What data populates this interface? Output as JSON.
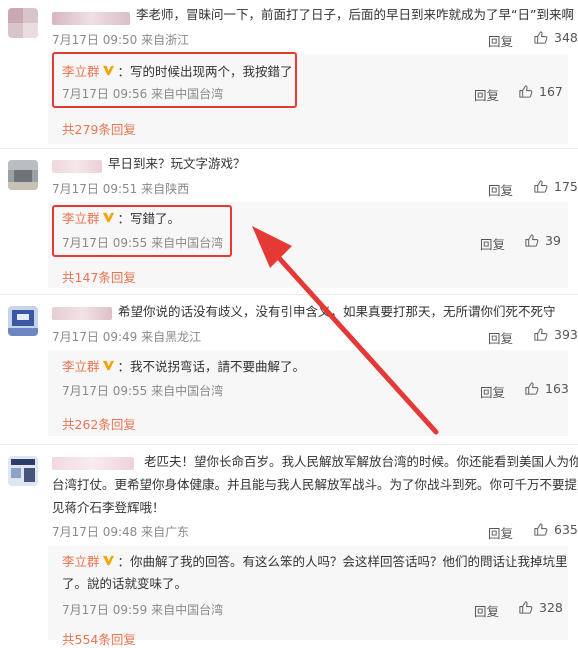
{
  "comments": [
    {
      "text": "李老师，冒昧问一下，前面打了日子，后面的早日到来咋就成为了早“日”到来啊",
      "meta": "7月17日 09:50 来自浙江",
      "reply_label": "回复",
      "likes": "348",
      "reply": {
        "author": "李立群",
        "text": "：写的时候出现两个，我按錯了",
        "meta": "7月17日 09:56 来自中国台湾",
        "reply_label": "回复",
        "likes": "167"
      },
      "more": "共279条回复"
    },
    {
      "text": "早日到来？玩文字游戏？",
      "meta": "7月17日 09:51 来自陕西",
      "reply_label": "回复",
      "likes": "175",
      "reply": {
        "author": "李立群",
        "text": "：写錯了。",
        "meta": "7月17日 09:55 来自中国台湾",
        "reply_label": "回复",
        "likes": "39"
      },
      "more": "共147条回复"
    },
    {
      "text": "希望你说的话没有歧义，没有引申含义，如果真要打那天，无所谓你们死不死守",
      "meta": "7月17日 09:49 来自黑龙江",
      "reply_label": "回复",
      "likes": "393",
      "reply": {
        "author": "李立群",
        "text": "：我不说拐弯话，請不要曲解了。",
        "meta": "7月17日 09:55 来自中国台湾",
        "reply_label": "回复",
        "likes": "163"
      },
      "more": "共262条回复"
    },
    {
      "text_lines": [
        "老匹夫！望你长命百岁。我人民解放军解放台湾的时候。你还能看到美国人为你",
        "台湾打仗。更希望你身体健康。并且能与我人民解放军战斗。为了你战斗到死。你可千万不要提前",
        "见蒋介石李登辉哦！"
      ],
      "meta": "7月17日 09:48 来自广东",
      "reply_label": "回复",
      "likes": "635",
      "reply": {
        "author": "李立群",
        "text_lines": [
          "：你曲解了我的回答。有这么笨的人吗？会这样回答话吗？他们的問话让我掉坑里",
          "了。說的话就变味了。"
        ],
        "meta": "7月17日 09:59 来自中国台湾",
        "reply_label": "回复",
        "likes": "328"
      },
      "more": "共554条回复"
    }
  ],
  "colors": {
    "author": "#eb7350",
    "annotation_red": "#e53935",
    "panel_bg": "#f7f7f7",
    "meta_text": "#8a8a8a"
  },
  "icons": {
    "like": "thumbs-up-icon",
    "verified": "verified-v-badge-icon"
  }
}
